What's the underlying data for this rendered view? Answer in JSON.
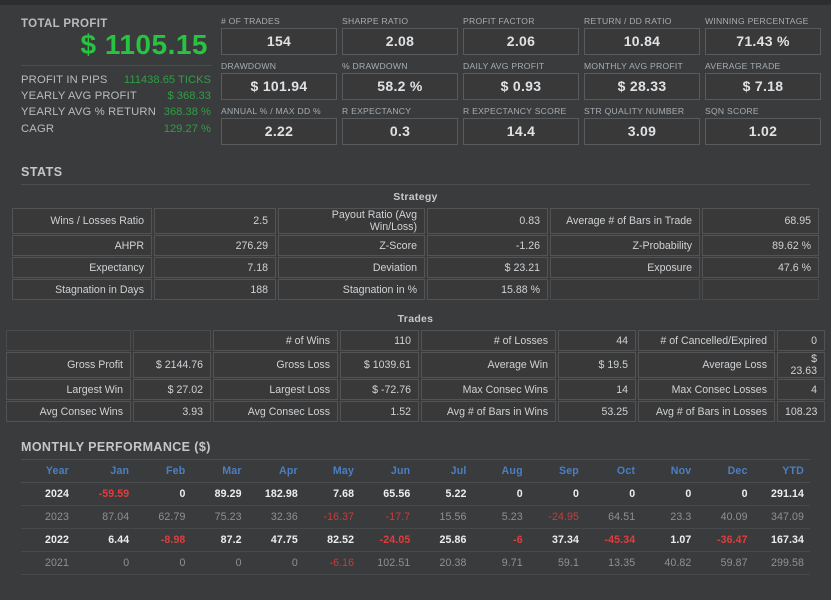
{
  "profit_panel": {
    "title": "TOTAL PROFIT",
    "total_profit": "$ 1105.15",
    "rows": [
      {
        "label": "PROFIT IN PIPS",
        "value": "111438.65 TICKS"
      },
      {
        "label": "YEARLY AVG PROFIT",
        "value": "$ 368.33"
      },
      {
        "label": "YEARLY AVG % RETURN",
        "value": "368.38 %"
      },
      {
        "label": "CAGR",
        "value": "129.27 %"
      }
    ]
  },
  "cards": [
    {
      "label": "# OF TRADES",
      "value": "154"
    },
    {
      "label": "SHARPE RATIO",
      "value": "2.08"
    },
    {
      "label": "PROFIT FACTOR",
      "value": "2.06"
    },
    {
      "label": "RETURN / DD RATIO",
      "value": "10.84"
    },
    {
      "label": "WINNING PERCENTAGE",
      "value": "71.43 %"
    },
    {
      "label": "DRAWDOWN",
      "value": "$ 101.94"
    },
    {
      "label": "% DRAWDOWN",
      "value": "58.2 %"
    },
    {
      "label": "DAILY AVG PROFIT",
      "value": "$ 0.93"
    },
    {
      "label": "MONTHLY AVG PROFIT",
      "value": "$ 28.33"
    },
    {
      "label": "AVERAGE TRADE",
      "value": "$ 7.18"
    },
    {
      "label": "ANNUAL % / MAX DD %",
      "value": "2.22"
    },
    {
      "label": "R EXPECTANCY",
      "value": "0.3"
    },
    {
      "label": "R EXPECTANCY SCORE",
      "value": "14.4"
    },
    {
      "label": "STR QUALITY NUMBER",
      "value": "3.09"
    },
    {
      "label": "SQN SCORE",
      "value": "1.02"
    }
  ],
  "stats": {
    "heading": "STATS",
    "strategy": {
      "title": "Strategy",
      "rows": [
        [
          {
            "k": "Wins / Losses Ratio",
            "v": "2.5"
          },
          {
            "k": "Payout Ratio (Avg Win/Loss)",
            "v": "0.83"
          },
          {
            "k": "Average # of Bars in Trade",
            "v": "68.95"
          }
        ],
        [
          {
            "k": "AHPR",
            "v": "276.29"
          },
          {
            "k": "Z-Score",
            "v": "-1.26"
          },
          {
            "k": "Z-Probability",
            "v": "89.62 %"
          }
        ],
        [
          {
            "k": "Expectancy",
            "v": "7.18"
          },
          {
            "k": "Deviation",
            "v": "$ 23.21"
          },
          {
            "k": "Exposure",
            "v": "47.6 %"
          }
        ],
        [
          {
            "k": "Stagnation in Days",
            "v": "188"
          },
          {
            "k": "Stagnation in %",
            "v": "15.88 %"
          },
          {
            "k": "",
            "v": ""
          }
        ]
      ]
    },
    "trades": {
      "title": "Trades",
      "rows": [
        [
          {
            "k": "",
            "v": ""
          },
          {
            "k": "# of Wins",
            "v": "110"
          },
          {
            "k": "# of Losses",
            "v": "44"
          },
          {
            "k": "# of Cancelled/Expired",
            "v": "0"
          }
        ],
        [
          {
            "k": "Gross Profit",
            "v": "$ 2144.76"
          },
          {
            "k": "Gross Loss",
            "v": "$ 1039.61"
          },
          {
            "k": "Average Win",
            "v": "$ 19.5"
          },
          {
            "k": "Average Loss",
            "v": "$ 23.63"
          }
        ],
        [
          {
            "k": "Largest Win",
            "v": "$ 27.02"
          },
          {
            "k": "Largest Loss",
            "v": "$ -72.76"
          },
          {
            "k": "Max Consec Wins",
            "v": "14"
          },
          {
            "k": "Max Consec Losses",
            "v": "4"
          }
        ],
        [
          {
            "k": "Avg Consec Wins",
            "v": "3.93"
          },
          {
            "k": "Avg Consec Loss",
            "v": "1.52"
          },
          {
            "k": "Avg # of Bars in Wins",
            "v": "53.25"
          },
          {
            "k": "Avg # of Bars in Losses",
            "v": "108.23"
          }
        ]
      ]
    }
  },
  "monthly": {
    "heading": "MONTHLY PERFORMANCE ($)",
    "columns": [
      "Year",
      "Jan",
      "Feb",
      "Mar",
      "Apr",
      "May",
      "Jun",
      "Jul",
      "Aug",
      "Sep",
      "Oct",
      "Nov",
      "Dec",
      "YTD"
    ],
    "rows": [
      {
        "year": "2024",
        "values": [
          "-59.59",
          "0",
          "89.29",
          "182.98",
          "7.68",
          "65.56",
          "5.22",
          "0",
          "0",
          "0",
          "0",
          "0",
          "291.14"
        ]
      },
      {
        "year": "2023",
        "values": [
          "87.04",
          "62.79",
          "75.23",
          "32.36",
          "-16.37",
          "-17.7",
          "15.56",
          "5.23",
          "-24.95",
          "64.51",
          "23.3",
          "40.09",
          "347.09"
        ]
      },
      {
        "year": "2022",
        "values": [
          "6.44",
          "-8.98",
          "87.2",
          "47.75",
          "82.52",
          "-24.05",
          "25.86",
          "-6",
          "37.34",
          "-45.34",
          "1.07",
          "-36.47",
          "167.34"
        ]
      },
      {
        "year": "2021",
        "values": [
          "0",
          "0",
          "0",
          "0",
          "-6.16",
          "102.51",
          "20.38",
          "9.71",
          "59.1",
          "13.35",
          "40.82",
          "59.87",
          "299.58"
        ]
      }
    ]
  },
  "colors": {
    "background": "#3a3b3c",
    "positive": "#2f9e45",
    "negative": "#e23c3c",
    "header_blue": "#4a7fc4",
    "text": "#cfd2d4"
  }
}
